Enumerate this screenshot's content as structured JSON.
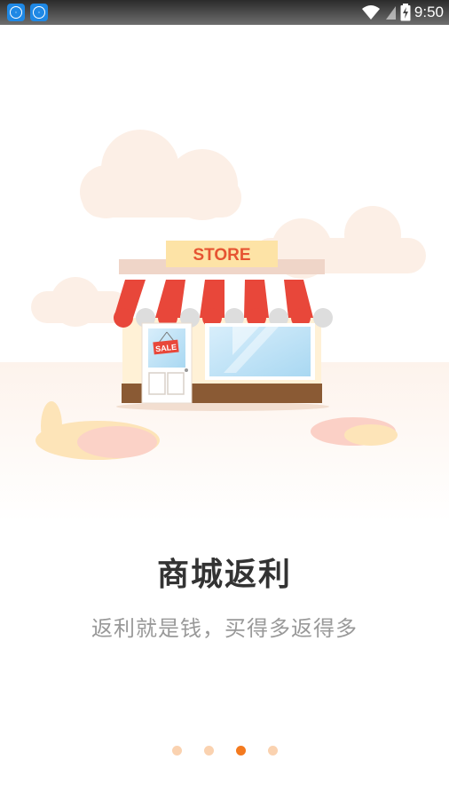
{
  "status_bar": {
    "time": "9:50",
    "icons": [
      "app-notification-icon",
      "app-notification-icon",
      "wifi-icon",
      "cellular-signal-icon",
      "battery-charging-icon"
    ]
  },
  "illustration": {
    "store_sign": "STORE",
    "sale_tag": "SALE"
  },
  "intro": {
    "title": "商城返利",
    "subtitle": "返利就是钱，买得多返得多"
  },
  "pager": {
    "count": 4,
    "active_index": 2,
    "colors": {
      "active": "#f47a1f",
      "inactive": "#fad2b0"
    }
  }
}
